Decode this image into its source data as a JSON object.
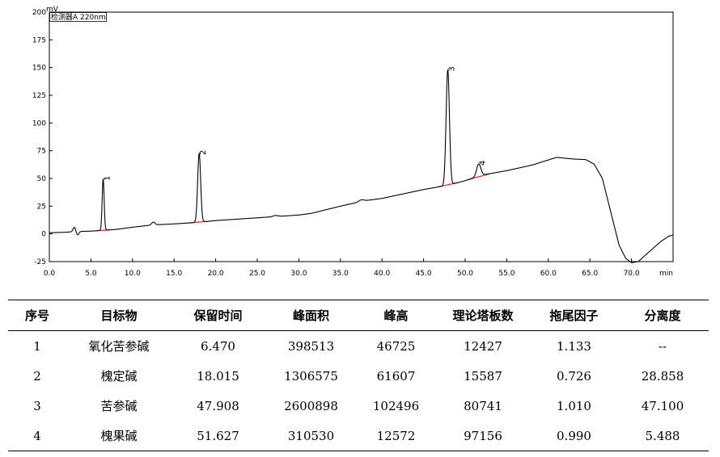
{
  "chart_data": {
    "type": "line",
    "detector_label": "检测器A 220nm",
    "ylabel": "mV",
    "xlabel": "min",
    "xlim": [
      0,
      75
    ],
    "ylim": [
      -25,
      200
    ],
    "x_ticks": [
      0,
      5,
      10,
      15,
      20,
      25,
      30,
      35,
      40,
      45,
      50,
      55,
      60,
      65,
      70
    ],
    "y_ticks": [
      -25,
      0,
      25,
      50,
      75,
      100,
      125,
      150,
      175,
      200
    ],
    "baseline": [
      [
        0,
        1
      ],
      [
        2,
        1.5
      ],
      [
        3,
        2
      ],
      [
        5,
        2.5
      ],
      [
        6,
        3
      ],
      [
        7,
        3.5
      ],
      [
        8,
        4
      ],
      [
        10,
        6
      ],
      [
        12.3,
        8
      ],
      [
        15,
        9
      ],
      [
        18,
        10.5
      ],
      [
        20,
        12
      ],
      [
        25,
        14.5
      ],
      [
        30,
        17
      ],
      [
        31.5,
        18.5
      ],
      [
        35,
        25
      ],
      [
        38,
        30
      ],
      [
        40,
        32
      ],
      [
        45,
        40
      ],
      [
        48,
        44
      ],
      [
        50,
        48
      ],
      [
        52,
        53
      ],
      [
        55,
        57
      ],
      [
        58,
        62
      ],
      [
        61,
        69
      ],
      [
        63,
        67.5
      ],
      [
        64.5,
        67
      ],
      [
        65.5,
        63
      ],
      [
        66.5,
        50
      ],
      [
        67.5,
        20
      ],
      [
        68.5,
        -10
      ],
      [
        69.3,
        -22
      ],
      [
        70,
        -26
      ],
      [
        70.8,
        -25
      ],
      [
        72,
        -17
      ],
      [
        73.5,
        -7
      ],
      [
        74.5,
        -2
      ],
      [
        75,
        -1
      ]
    ],
    "artifacts": [
      {
        "x": 3.0,
        "h": 4,
        "w": 0.15
      },
      {
        "x": 3.4,
        "h": -3,
        "w": 0.15
      },
      {
        "x": 12.5,
        "h": 2.5,
        "w": 0.2
      },
      {
        "x": 27.2,
        "h": 1,
        "w": 0.3
      },
      {
        "x": 37.5,
        "h": 1.5,
        "w": 0.3
      }
    ],
    "peaks": [
      {
        "id": "1",
        "x": 6.47,
        "height": 46,
        "width": 0.12
      },
      {
        "id": "2",
        "x": 18.015,
        "height": 62,
        "width": 0.18
      },
      {
        "id": "3",
        "x": 47.908,
        "height": 104,
        "width": 0.2
      },
      {
        "id": "4",
        "x": 51.627,
        "height": 11,
        "width": 0.25
      }
    ]
  },
  "table": {
    "headers": [
      "序号",
      "目标物",
      "保留时间",
      "峰面积",
      "峰高",
      "理论塔板数",
      "拖尾因子",
      "分离度"
    ],
    "rows": [
      [
        "1",
        "氧化苦参碱",
        "6.470",
        "398513",
        "46725",
        "12427",
        "1.133",
        "--"
      ],
      [
        "2",
        "槐定碱",
        "18.015",
        "1306575",
        "61607",
        "15587",
        "0.726",
        "28.858"
      ],
      [
        "3",
        "苦参碱",
        "47.908",
        "2600898",
        "102496",
        "80741",
        "1.010",
        "47.100"
      ],
      [
        "4",
        "槐果碱",
        "51.627",
        "310530",
        "12572",
        "97156",
        "0.990",
        "5.488"
      ]
    ]
  }
}
